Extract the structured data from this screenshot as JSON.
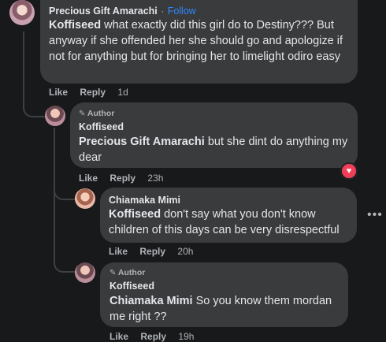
{
  "comments": [
    {
      "author": "Precious Gift Amarachi",
      "follow_label": "Follow",
      "separator": "·",
      "mention": "Koffiseed",
      "text": " what exactly did this girl do to Destiny??? But anyway if she offended her she should go and apologize if not for anything but for bringing her to limelight odiro easy",
      "actions": {
        "like": "Like",
        "reply": "Reply",
        "time": "1d"
      }
    },
    {
      "author_badge": "Author",
      "author": "Koffiseed",
      "mention": "Precious Gift Amarachi",
      "text": " but she dint do anything my dear",
      "actions": {
        "like": "Like",
        "reply": "Reply",
        "time": "23h"
      },
      "reaction": "love"
    },
    {
      "author": "Chiamaka Mimi",
      "mention": "Koffiseed",
      "text": " don't say what you don't know children of this days can be very disrespectful",
      "actions": {
        "like": "Like",
        "reply": "Reply",
        "time": "20h"
      },
      "more_icon": "ellipsis-icon"
    },
    {
      "author_badge": "Author",
      "author": "Koffiseed",
      "mention": "Chiamaka Mimi",
      "text": " So you know them mordan me right ??",
      "actions": {
        "like": "Like",
        "reply": "Reply",
        "time": "19h"
      }
    }
  ]
}
